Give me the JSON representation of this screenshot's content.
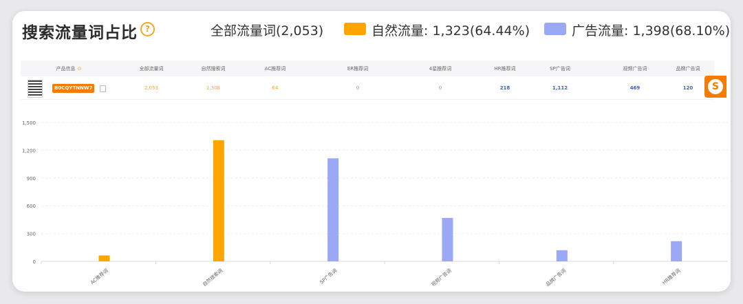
{
  "header": {
    "title": "搜索流量词占比",
    "help_icon": "question-circle-icon",
    "total_label": "全部流量词(2,053)",
    "organic_label": "自然流量: 1,323(64.44%)",
    "ad_label": "广告流量: 1,398(68.10%)",
    "organic_color": "#ffa500",
    "ad_color": "#9aa8f6"
  },
  "table": {
    "headers": [
      "产品信息",
      "全部流量词",
      "自然搜索词",
      "AC推荐词",
      "ER推荐词",
      "4星推荐词",
      "HR推荐词",
      "SP广告词",
      "视频广告词",
      "品牌广告词"
    ],
    "row": {
      "asin": "B0CQYTNNW7",
      "values": [
        "2,053",
        "1,308",
        "64",
        "0",
        "0",
        "218",
        "1,112",
        "469",
        "120"
      ]
    },
    "value_colors": [
      "#f5a623",
      "#f5a623",
      "#f5a623",
      "#999999",
      "#999999",
      "#3b5bdb",
      "#3b5bdb",
      "#3b5bdb",
      "#3b5bdb"
    ]
  },
  "chart_data": {
    "type": "bar",
    "categories": [
      "AC推荐词",
      "自然搜索词",
      "SP广告词",
      "视频广告词",
      "品牌广告词",
      "HR推荐词"
    ],
    "values": [
      64,
      1308,
      1112,
      469,
      120,
      218
    ],
    "colors": [
      "#ffa500",
      "#ffa500",
      "#9aa8f6",
      "#9aa8f6",
      "#9aa8f6",
      "#9aa8f6"
    ],
    "ylim": [
      0,
      1500
    ],
    "yticks": [
      "0",
      "300",
      "600",
      "900",
      "1,200",
      "1,500"
    ],
    "grid": true
  }
}
